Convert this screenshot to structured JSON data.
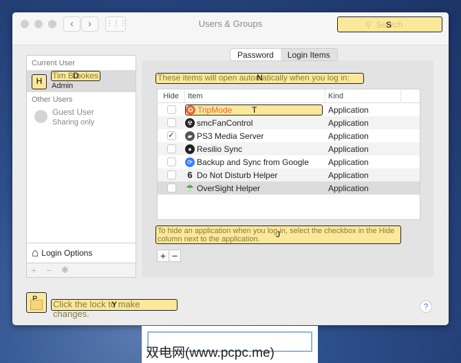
{
  "window": {
    "title": "Users & Groups",
    "search_placeholder": "Search",
    "search_hint": "S"
  },
  "sidebar": {
    "current_user_label": "Current User",
    "user_name": "Tim Brookes",
    "user_role": "Admin",
    "user_hint": "D",
    "avatar_hint": "H",
    "other_users_label": "Other Users",
    "guest_name": "Guest User",
    "guest_status": "Sharing only",
    "login_options": "Login Options"
  },
  "tabs": [
    {
      "label": "Password"
    },
    {
      "label": "Login Items"
    }
  ],
  "login_items": {
    "intro": "These items will open automatically when you log in:",
    "intro_hint": "N",
    "columns": [
      "Hide",
      "Item",
      "Kind"
    ],
    "rows": [
      {
        "name": "TripMode",
        "kind": "Application",
        "hidden": false,
        "hint": "T"
      },
      {
        "name": "smcFanControl",
        "kind": "Application",
        "hidden": false
      },
      {
        "name": "PS3 Media Server",
        "kind": "Application",
        "hidden": true
      },
      {
        "name": "Resilio Sync",
        "kind": "Application",
        "hidden": false
      },
      {
        "name": "Backup and Sync from Google",
        "kind": "Application",
        "hidden": false
      },
      {
        "name": "Do Not Disturb Helper",
        "kind": "Application",
        "hidden": false
      },
      {
        "name": "OverSight Helper",
        "kind": "Application",
        "hidden": false
      }
    ],
    "help_text": "To hide an application when you log in, select the checkbox in the Hide column next to the application.",
    "help_hint": "J"
  },
  "footer": {
    "lock_text": "Click the lock to make changes.",
    "lock_hint": "P",
    "lock_text_hint": "Y",
    "help": "?"
  },
  "watermark": "双电网(www.pcpc.me)"
}
